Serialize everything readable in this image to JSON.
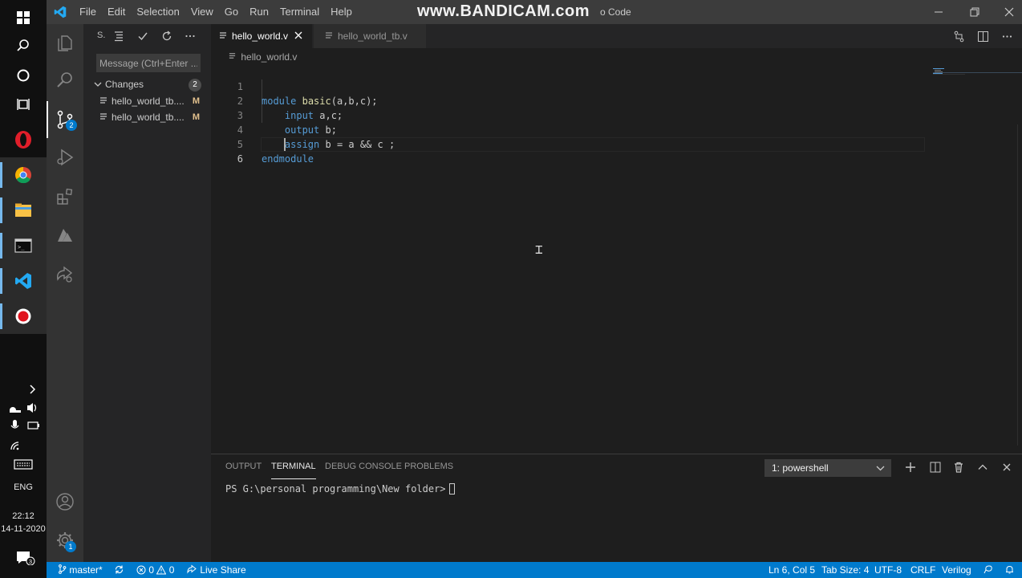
{
  "window": {
    "menu": [
      "File",
      "Edit",
      "Selection",
      "View",
      "Go",
      "Run",
      "Terminal",
      "Help"
    ],
    "watermark": "www.BANDICAM.com",
    "title_fragment": "o Code",
    "controls": [
      "minimize",
      "restore",
      "close"
    ]
  },
  "taskbar": {
    "apps": [
      "windows-start-icon",
      "search-icon",
      "cortana-icon",
      "task-view-icon",
      "opera-icon",
      "chrome-icon",
      "file-explorer-icon",
      "terminal-icon",
      "vscode-icon",
      "bandicam-record-icon"
    ],
    "language": "ENG",
    "time": "22:12",
    "date": "14-11-2020",
    "notification_count": "3"
  },
  "activity_bar": {
    "scm_badge": "2",
    "settings_badge": "1"
  },
  "sidebar": {
    "title": "S.",
    "message_placeholder": "Message (Ctrl+Enter ...",
    "changes_label": "Changes",
    "changes_count": "2",
    "files": [
      {
        "name": "hello_world_tb....",
        "status": "M"
      },
      {
        "name": "hello_world_tb....",
        "status": "M"
      }
    ]
  },
  "tabs": [
    {
      "label": "hello_world.v",
      "active": true
    },
    {
      "label": "hello_world_tb.v",
      "active": false
    }
  ],
  "editor": {
    "breadcrumb": "hello_world.v",
    "line_numbers": [
      "1",
      "2",
      "3",
      "4",
      "5",
      "6"
    ],
    "lines": {
      "l1_kw": "module",
      "l1_fn": "basic",
      "l1_rest": "(a,b,c);",
      "l2_kw": "input",
      "l2_rest": " a,c;",
      "l3_kw": "output",
      "l3_rest": " b;",
      "l4_kw": "assign",
      "l4_rest": " b = a && c ;",
      "l5_kw": "endmodule"
    }
  },
  "panel": {
    "tabs": [
      "OUTPUT",
      "TERMINAL",
      "DEBUG CONSOLE",
      "PROBLEMS"
    ],
    "active_tab": "TERMINAL",
    "terminal_selector": "1: powershell",
    "prompt": "PS G:\\personal programming\\New folder>"
  },
  "statusbar": {
    "branch": "master*",
    "errors": "0",
    "warnings": "0",
    "live_share": "Live Share",
    "position": "Ln 6, Col 5",
    "tab_size": "Tab Size: 4",
    "encoding": "UTF-8",
    "eol": "CRLF",
    "language": "Verilog"
  },
  "colors": {
    "accent": "#007acc",
    "keyword": "#569cd6",
    "function": "#dcdcaa",
    "modified": "#e2c08d"
  }
}
